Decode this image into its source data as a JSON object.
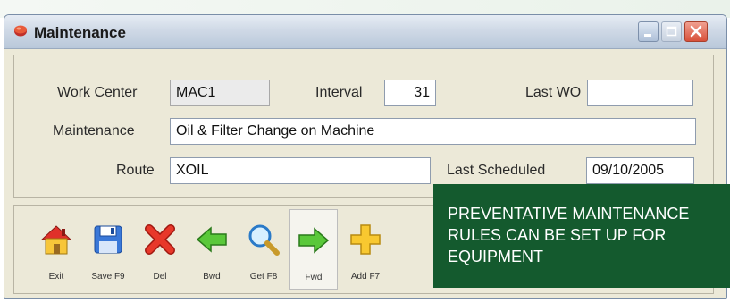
{
  "window": {
    "title": "Maintenance"
  },
  "form": {
    "work_center_label": "Work Center",
    "work_center_value": "MAC1",
    "interval_label": "Interval",
    "interval_value": "31",
    "last_wo_label": "Last WO",
    "last_wo_value": "",
    "maintenance_label": "Maintenance",
    "maintenance_value": "Oil & Filter Change on Machine",
    "route_label": "Route",
    "route_value": "XOIL",
    "last_scheduled_label": "Last Scheduled",
    "last_scheduled_value": "09/10/2005"
  },
  "toolbar": {
    "items": [
      {
        "label": "Exit",
        "icon": "home-icon"
      },
      {
        "label": "Save F9",
        "icon": "floppy-disk-icon"
      },
      {
        "label": "Del",
        "icon": "red-x-icon"
      },
      {
        "label": "Bwd",
        "icon": "left-arrow-icon"
      },
      {
        "label": "Get F8",
        "icon": "magnifier-icon"
      },
      {
        "label": "Fwd",
        "icon": "right-arrow-icon"
      },
      {
        "label": "Add F7",
        "icon": "plus-icon"
      }
    ]
  },
  "callout": {
    "lines": [
      "PREVENTATIVE MAINTENANCE",
      "RULES CAN BE SET UP FOR",
      "EQUIPMENT"
    ]
  },
  "colors": {
    "callout_bg": "#145a2e",
    "window_bg": "#ece9d8",
    "close_button": "#d8503a"
  }
}
